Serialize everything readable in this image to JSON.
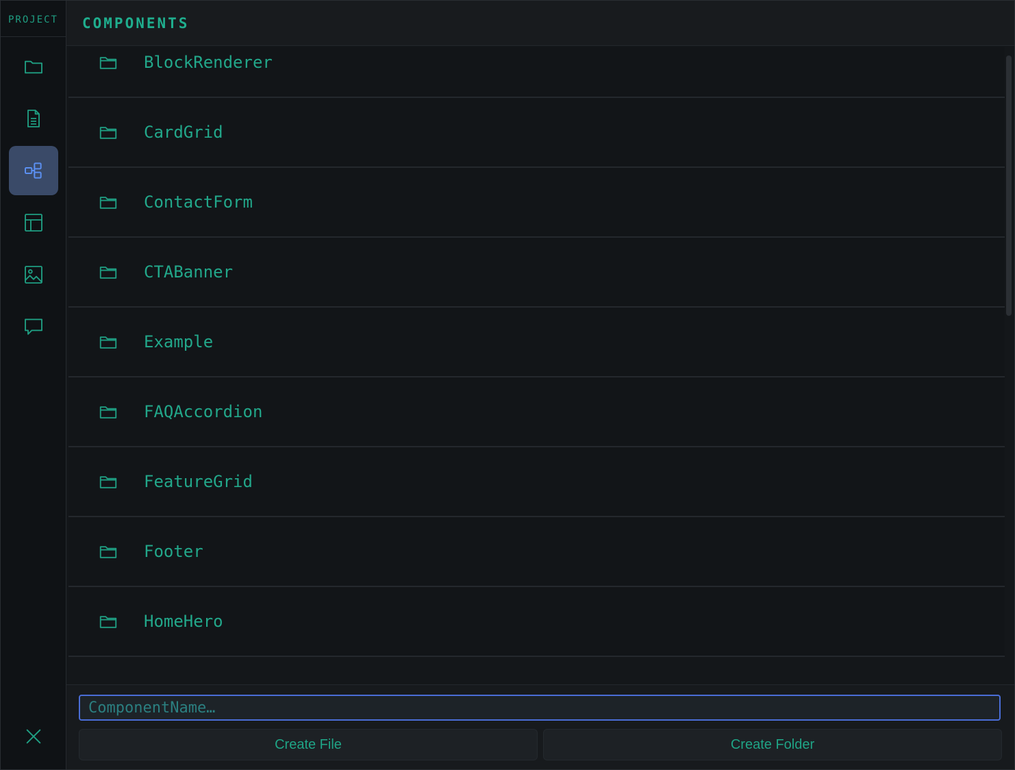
{
  "rail": {
    "title": "PROJECT",
    "items": [
      {
        "icon": "folder-icon"
      },
      {
        "icon": "document-icon"
      },
      {
        "icon": "components-icon",
        "active": true
      },
      {
        "icon": "layout-icon"
      },
      {
        "icon": "image-icon"
      },
      {
        "icon": "chat-icon"
      }
    ],
    "close_icon": "close-icon"
  },
  "header": {
    "title": "COMPONENTS"
  },
  "list": {
    "items": [
      {
        "label": "BlockRenderer"
      },
      {
        "label": "CardGrid"
      },
      {
        "label": "ContactForm"
      },
      {
        "label": "CTABanner"
      },
      {
        "label": "Example"
      },
      {
        "label": "FAQAccordion"
      },
      {
        "label": "FeatureGrid"
      },
      {
        "label": "Footer"
      },
      {
        "label": "HomeHero"
      }
    ]
  },
  "footer": {
    "input_placeholder": "ComponentName…",
    "create_file_label": "Create File",
    "create_folder_label": "Create Folder"
  },
  "colors": {
    "accent": "#22a78a",
    "active_bg": "#3a4a68",
    "active_icon": "#5b8ff0",
    "input_border": "#4a6dd6"
  }
}
